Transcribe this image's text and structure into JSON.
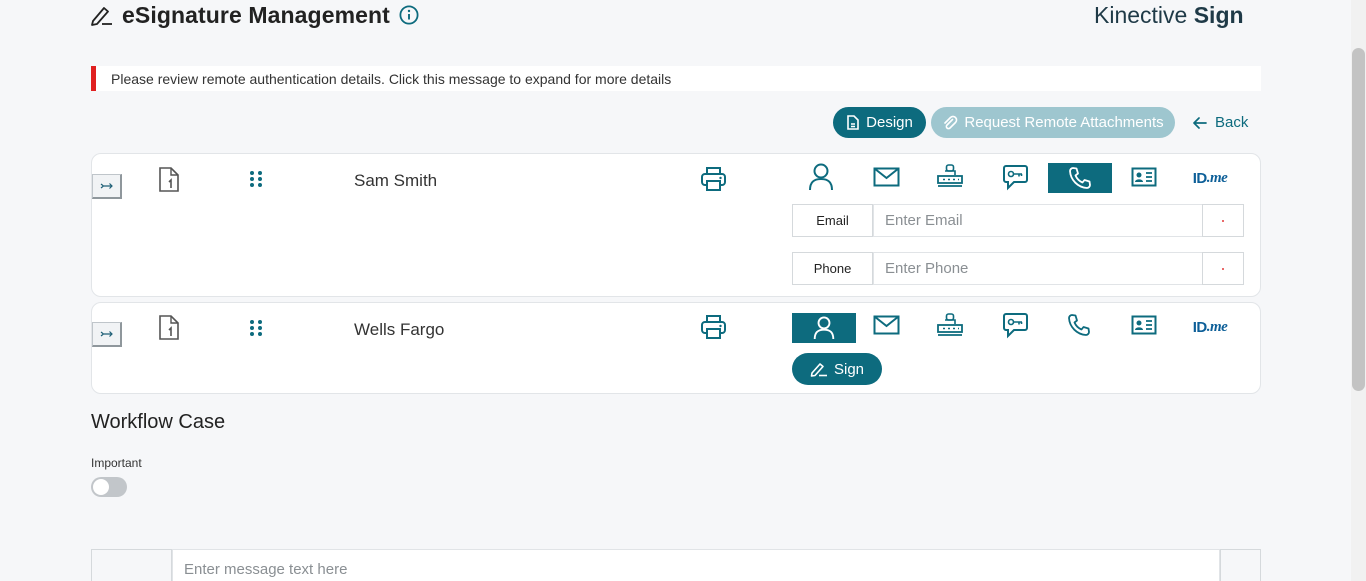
{
  "header": {
    "title": "eSignature Management",
    "brand_light": "Kinective",
    "brand_bold": "Sign",
    "icons": [
      "pen-icon",
      "info-icon"
    ]
  },
  "alert": {
    "message": "Please review remote authentication details. Click this message to expand for more details"
  },
  "toolbar": {
    "design_label": "Design",
    "attach_label": "Request Remote Attachments",
    "back_label": "Back"
  },
  "signers": [
    {
      "name": "Sam Smith",
      "active_auth": "phone",
      "fields": [
        {
          "label": "Email",
          "placeholder": "Enter Email"
        },
        {
          "label": "Phone",
          "placeholder": "Enter Phone"
        }
      ]
    },
    {
      "name": "Wells Fargo",
      "active_auth": "in-person",
      "sign_label": "Sign"
    }
  ],
  "auth_methods": [
    "in-person",
    "email",
    "kba",
    "sms",
    "phone",
    "id-card",
    "idme"
  ],
  "idme": {
    "id": "ID",
    "me": ".me"
  },
  "workflow": {
    "title": "Workflow Case",
    "important_label": "Important",
    "important_on": false,
    "message_placeholder": "Enter message text here"
  },
  "colors": {
    "primary": "#0d6b7e",
    "primary_disabled": "#9ec6cf",
    "alert": "#e02020",
    "idme": "#0d5f98"
  }
}
